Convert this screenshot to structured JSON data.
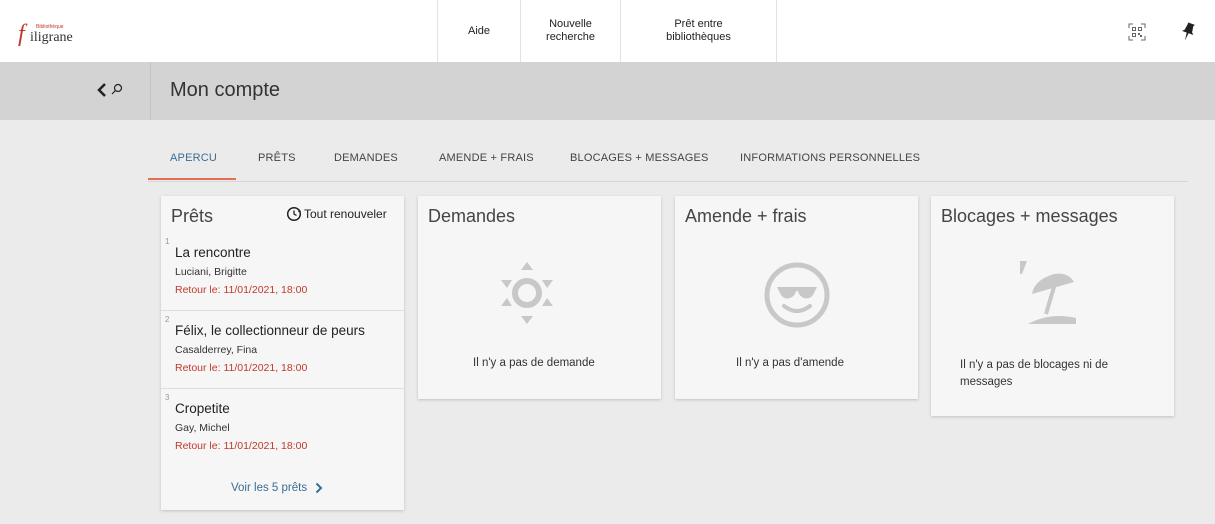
{
  "header": {
    "logo_small": "Bibliothèque",
    "logo_f": "f",
    "logo_name": "iligrane",
    "nav": [
      {
        "label": "Aide"
      },
      {
        "label_line1": "Nouvelle",
        "label_line2": "recherche"
      },
      {
        "label_line1": "Prêt entre",
        "label_line2": "bibliothèques"
      }
    ],
    "icons": [
      "qr-code-icon",
      "pin-icon"
    ]
  },
  "subheader": {
    "back_icon": "back-search-icon",
    "title": "Mon compte"
  },
  "tabs": [
    {
      "label": "APERCU",
      "active": true
    },
    {
      "label": "PRÊTS"
    },
    {
      "label": "DEMANDES"
    },
    {
      "label": "AMENDE + FRAIS"
    },
    {
      "label": "BLOCAGES + MESSAGES"
    },
    {
      "label": "INFORMATIONS PERSONNELLES"
    }
  ],
  "loans": {
    "title": "Prêts",
    "renew_label": "Tout renouveler",
    "items": [
      {
        "num": "1",
        "title": "La rencontre",
        "author": "Luciani, Brigitte",
        "due": "Retour le: 11/01/2021, 18:00"
      },
      {
        "num": "2",
        "title": "Félix, le collectionneur de peurs",
        "author": "Casalderrey, Fina",
        "due": "Retour le: 11/01/2021, 18:00"
      },
      {
        "num": "3",
        "title": "Cropetite",
        "author": "Gay, Michel",
        "due": "Retour le: 11/01/2021, 18:00"
      }
    ],
    "view_all": "Voir les 5 prêts"
  },
  "demandes": {
    "title": "Demandes",
    "icon": "sun-icon",
    "message": "Il n'y a pas de demande"
  },
  "amendes": {
    "title": "Amende + frais",
    "icon": "sunglasses-smiley-icon",
    "message": "Il n'y a pas d'amende"
  },
  "blocages": {
    "title": "Blocages + messages",
    "icon": "beach-umbrella-icon",
    "message_line1": "Il n'y a pas de blocages ni de",
    "message_line2": "messages"
  },
  "colors": {
    "accent": "#3a6d94",
    "due": "#c0392b",
    "tab_underline": "#e07055",
    "icon_gray": "#c8c8c8"
  }
}
